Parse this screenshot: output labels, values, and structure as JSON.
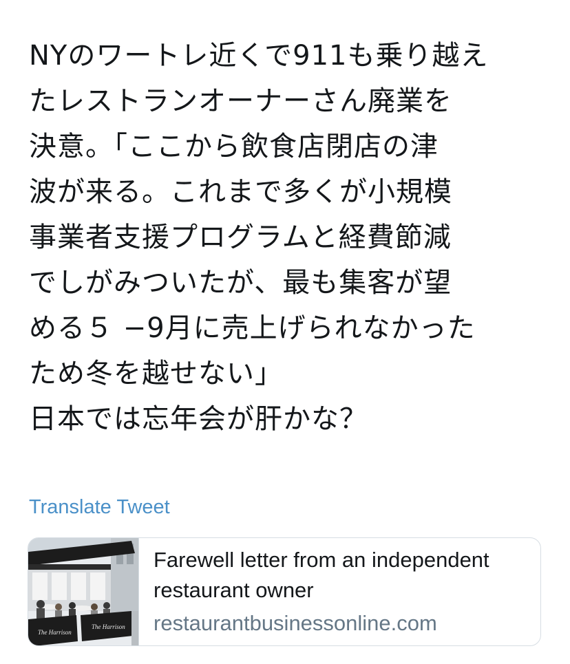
{
  "tweet": {
    "text_lines": [
      "NYのワートレ近くで911も乗り越え",
      "たレストランオーナーさん廃業を",
      "決意。「ここから飲食店閉店の津",
      "波が来る。これまで多くが小規模",
      "事業者支援プログラムと経費節減",
      "でしがみついたが、最も集客が望",
      "める５ −9月に売上げられなかった",
      "ため冬を越せない」",
      "日本では忘年会が肝かな？"
    ]
  },
  "translate": {
    "label": "Translate Tweet"
  },
  "card": {
    "title": "Farewell letter from an independent restaurant owner",
    "domain": "restaurantbusinessonline.com",
    "awning_texts": [
      "The Harrison",
      "The Harrison"
    ]
  },
  "colors": {
    "text": "#14171a",
    "link": "#4a90c8",
    "muted": "#657786",
    "border": "#d6dde3",
    "awning": "#1c1c1c"
  }
}
